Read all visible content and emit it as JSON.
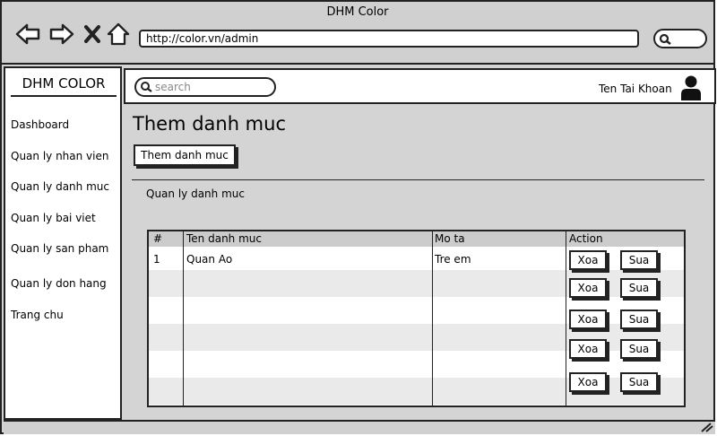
{
  "window": {
    "title": "DHM Color"
  },
  "browser": {
    "url": "http://color.vn/admin"
  },
  "sidebar": {
    "brand": "DHM COLOR",
    "items": [
      {
        "label": "Dashboard"
      },
      {
        "label": "Quan ly nhan vien"
      },
      {
        "label": "Quan ly danh muc"
      },
      {
        "label": "Quan ly bai viet"
      },
      {
        "label": "Quan ly san pham"
      },
      {
        "label": "Quan ly don hang"
      },
      {
        "label": "Trang chu"
      }
    ]
  },
  "topbar": {
    "search_placeholder": "search",
    "account": "Ten Tai Khoan"
  },
  "main": {
    "title": "Them danh muc",
    "add_button": "Them danh muc",
    "section_label": "Quan ly danh muc",
    "table": {
      "columns": [
        "#",
        "Ten danh muc",
        "Mo ta",
        "Action"
      ],
      "rows": [
        {
          "id": "1",
          "name": "Quan Ao",
          "desc": "Tre em"
        }
      ],
      "delete_label": "Xoa",
      "edit_label": "Sua"
    }
  },
  "icons": [
    "back-icon",
    "forward-icon",
    "close-icon",
    "home-icon",
    "search-icon",
    "user-icon",
    "resize-grip-icon"
  ]
}
